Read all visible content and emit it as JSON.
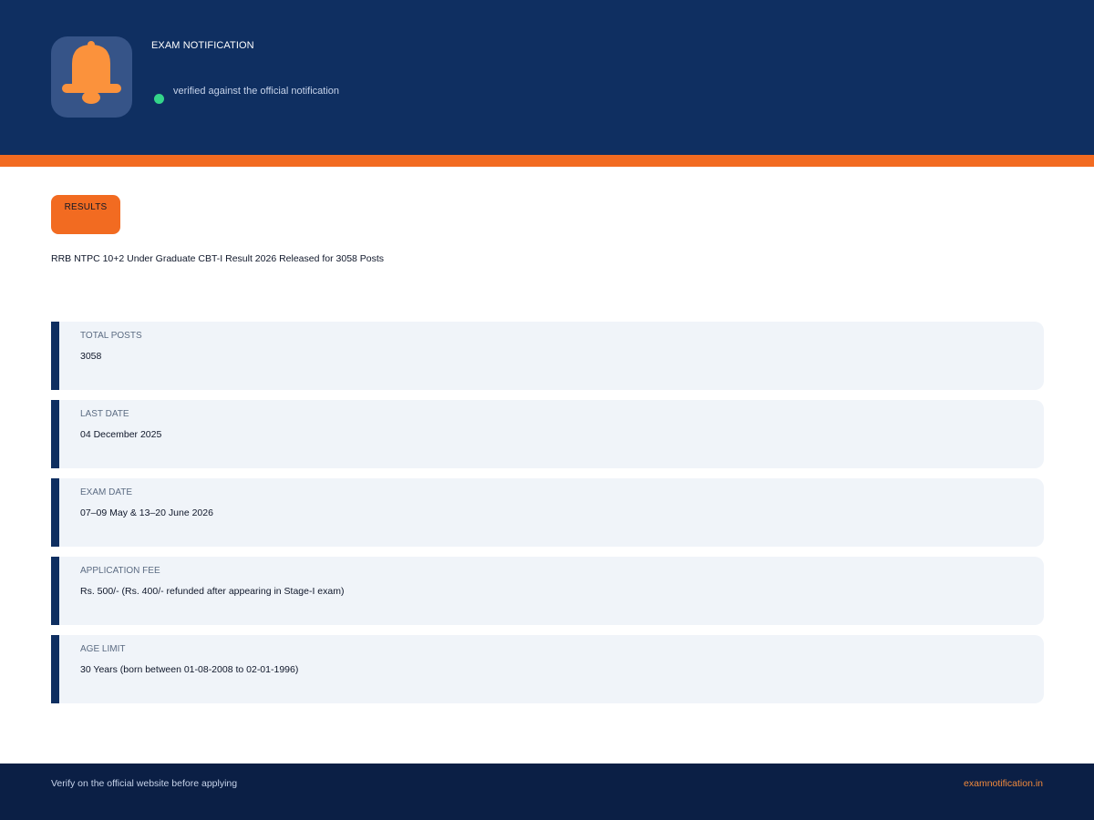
{
  "header": {
    "icon": "bell-icon",
    "label": "EXAM NOTIFICATION",
    "status_text": "verified against the official notification"
  },
  "main": {
    "category": "RESULTS",
    "title": "RRB NTPC 10+2 Under Graduate CBT-I Result 2026 Released for 3058 Posts",
    "cards": [
      {
        "label": "TOTAL POSTS",
        "value": "3058"
      },
      {
        "label": "LAST DATE",
        "value": "04 December 2025"
      },
      {
        "label": "EXAM DATE",
        "value": "07–09 May & 13–20 June 2026"
      },
      {
        "label": "APPLICATION FEE",
        "value": "Rs. 500/- (Rs. 400/- refunded after appearing in Stage-I exam)"
      },
      {
        "label": "AGE LIMIT",
        "value": "30 Years (born between 01-08-2008 to 02-01-1996)"
      }
    ]
  },
  "footer": {
    "note": "Verify on the official website before applying",
    "site": "examnotification.in"
  },
  "colors": {
    "header_bg": "#0f2f61",
    "accent": "#f26b21",
    "status_ok": "#34d58a",
    "card_bg": "#f0f4f9",
    "footer_bg": "#0b1f45"
  }
}
